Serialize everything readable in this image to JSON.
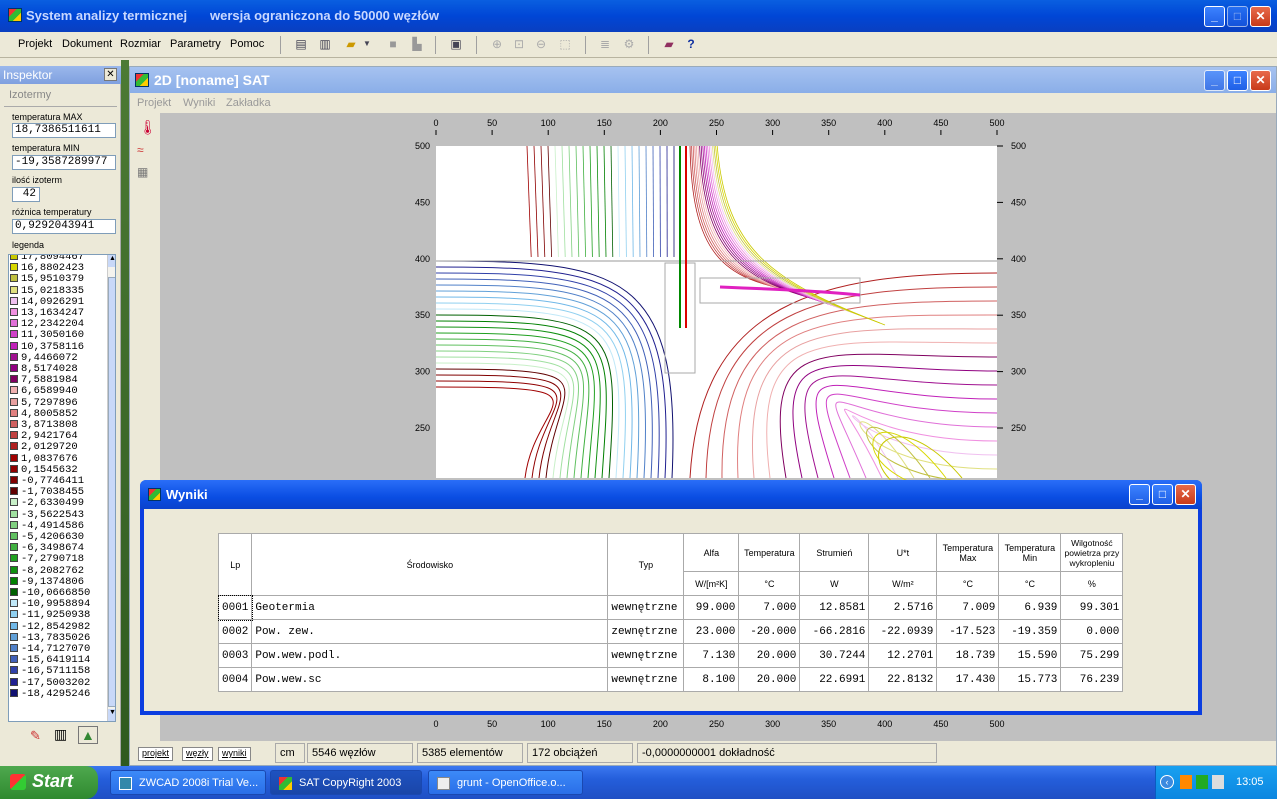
{
  "app": {
    "title": "System analizy termicznej",
    "subtitle": "wersja ograniczona do 50000 węzłów"
  },
  "menu": [
    "Projekt",
    "Dokument",
    "Rozmiar",
    "Parametry",
    "Pomoc"
  ],
  "inspector": {
    "title": "Inspektor",
    "tab": "Izotermy",
    "temp_max_label": "temperatura MAX",
    "temp_max": "18,7386511611",
    "temp_min_label": "temperatura MIN",
    "temp_min": "-19,3587289977",
    "count_label": "ilość izoterm",
    "count": "42",
    "diff_label": "różnica temperatury",
    "diff": "0,9292043941",
    "legend_label": "legenda",
    "legend": [
      {
        "v": "17,8094467",
        "c": "#c8c800"
      },
      {
        "v": "16,8802423",
        "c": "#d8d800"
      },
      {
        "v": "15,9510379",
        "c": "#c0c040"
      },
      {
        "v": "15,0218335",
        "c": "#e0e080"
      },
      {
        "v": "14,0926291",
        "c": "#f0c0f0"
      },
      {
        "v": "13,1634247",
        "c": "#f090e0"
      },
      {
        "v": "12,2342204",
        "c": "#e070d8"
      },
      {
        "v": "11,3050160",
        "c": "#d040c8"
      },
      {
        "v": "10,3758116",
        "c": "#c020b8"
      },
      {
        "v": "9,4466072",
        "c": "#a01090"
      },
      {
        "v": "8,5174028",
        "c": "#900080"
      },
      {
        "v": "7,5881984",
        "c": "#800060"
      },
      {
        "v": "6,6589940",
        "c": "#f0b0b0"
      },
      {
        "v": "5,7297896",
        "c": "#e8a0a0"
      },
      {
        "v": "4,8005852",
        "c": "#e08080"
      },
      {
        "v": "3,8713808",
        "c": "#d06060"
      },
      {
        "v": "2,9421764",
        "c": "#c04040"
      },
      {
        "v": "2,0129720",
        "c": "#b02020"
      },
      {
        "v": "1,0837676",
        "c": "#a00000"
      },
      {
        "v": "0,1545632",
        "c": "#900000"
      },
      {
        "v": "-0,7746411",
        "c": "#800000"
      },
      {
        "v": "-1,7038455",
        "c": "#600000"
      },
      {
        "v": "-2,6330499",
        "c": "#c8f0c8"
      },
      {
        "v": "-3,5622543",
        "c": "#a0e0a0"
      },
      {
        "v": "-4,4914586",
        "c": "#80d080"
      },
      {
        "v": "-5,4206630",
        "c": "#60c060"
      },
      {
        "v": "-6,3498674",
        "c": "#40b040"
      },
      {
        "v": "-7,2790718",
        "c": "#20a020"
      },
      {
        "v": "-8,2082762",
        "c": "#109010"
      },
      {
        "v": "-9,1374806",
        "c": "#008000"
      },
      {
        "v": "-10,0666850",
        "c": "#006000"
      },
      {
        "v": "-10,9958894",
        "c": "#c0e8f8"
      },
      {
        "v": "-11,9250938",
        "c": "#90d0f0"
      },
      {
        "v": "-12,8542982",
        "c": "#70b8e8"
      },
      {
        "v": "-13,7835026",
        "c": "#60a0d8"
      },
      {
        "v": "-14,7127070",
        "c": "#5080c8"
      },
      {
        "v": "-15,6419114",
        "c": "#4060b8"
      },
      {
        "v": "-16,5711158",
        "c": "#3040a8"
      },
      {
        "v": "-17,5003202",
        "c": "#202090"
      },
      {
        "v": "-18,4295246",
        "c": "#101070"
      }
    ]
  },
  "win2d": {
    "title": "2D   [noname]  SAT",
    "menu": [
      "Projekt",
      "Wyniki",
      "Zakładka"
    ],
    "x_ticks": [
      "0",
      "50",
      "100",
      "150",
      "200",
      "250",
      "300",
      "350",
      "400",
      "450",
      "500"
    ],
    "y_ticks": [
      "500",
      "450",
      "400",
      "350",
      "300",
      "250"
    ],
    "tabs": [
      "projekt",
      "węzły",
      "wyniki"
    ],
    "status": [
      "cm",
      "5546 węzłów",
      "5385 elementów",
      "172 obciążeń",
      "-0,0000000001 dokładność"
    ]
  },
  "wyniki": {
    "title": "Wyniki",
    "headers": [
      "Lp",
      "Środowisko",
      "Typ",
      "Alfa",
      "Temperatura",
      "Strumień",
      "U*t",
      "Temperatura Max",
      "Temperatura Min",
      "Wilgotność powietrza przy wykropleniu"
    ],
    "units": [
      "W/[m²K]",
      "°C",
      "W",
      "W/m²",
      "°C",
      "°C",
      "%"
    ],
    "rows": [
      [
        "0001",
        "Geotermia",
        "wewnętrzne",
        "99.000",
        "7.000",
        "12.8581",
        "2.5716",
        "7.009",
        "6.939",
        "99.301"
      ],
      [
        "0002",
        "Pow. zew.",
        "zewnętrzne",
        "23.000",
        "-20.000",
        "-66.2816",
        "-22.0939",
        "-17.523",
        "-19.359",
        "0.000"
      ],
      [
        "0003",
        "Pow.wew.podl.",
        "wewnętrzne",
        "7.130",
        "20.000",
        "30.7244",
        "12.2701",
        "18.739",
        "15.590",
        "75.299"
      ],
      [
        "0004",
        "Pow.wew.sc",
        "wewnętrzne",
        "8.100",
        "20.000",
        "22.6991",
        "22.8132",
        "17.430",
        "15.773",
        "76.239"
      ]
    ]
  },
  "taskbar": {
    "start": "Start",
    "items": [
      "ZWCAD 2008i Trial Ve...",
      "SAT CopyRight 2003",
      "grunt - OpenOffice.o..."
    ],
    "clock": "13:05"
  }
}
